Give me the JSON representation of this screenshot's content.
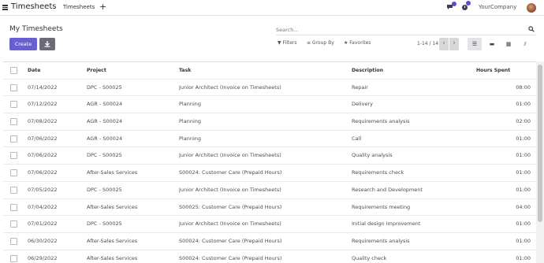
{
  "navbar": {
    "app_title": "Timesheets",
    "menu_link": "Timesheets",
    "add_label": "+",
    "company": "YourCompany",
    "accent": "#5b4dc9"
  },
  "control_panel": {
    "title": "My Timesheets",
    "create_label": "Create",
    "search_placeholder": "Search...",
    "filters_label": "▼ Filters",
    "groupby_label": "≡ Group By",
    "favorites_label": "★ Favorites",
    "pager": "1-14 / 14",
    "prev": "‹",
    "next": "›",
    "views": {
      "list": "☰",
      "kanban": "▬",
      "grid": "▦",
      "graph": "⫽"
    }
  },
  "table": {
    "headers": {
      "date": "Date",
      "project": "Project",
      "task": "Task",
      "description": "Description",
      "hours": "Hours Spent"
    },
    "rows": [
      {
        "date": "07/14/2022",
        "project": "DPC - S00025",
        "task": "Junior Architect (Invoice on Timesheets)",
        "description": "Repair",
        "hours": "08:00"
      },
      {
        "date": "07/12/2022",
        "project": "AGR - S00024",
        "task": "Planning",
        "description": "Delivery",
        "hours": "01:00"
      },
      {
        "date": "07/08/2022",
        "project": "AGR - S00024",
        "task": "Planning",
        "description": "Requirements analysis",
        "hours": "02:00"
      },
      {
        "date": "07/06/2022",
        "project": "AGR - S00024",
        "task": "Planning",
        "description": "Call",
        "hours": "01:00"
      },
      {
        "date": "07/06/2022",
        "project": "DPC - S00025",
        "task": "Junior Architect (Invoice on Timesheets)",
        "description": "Quality analysis",
        "hours": "01:00"
      },
      {
        "date": "07/06/2022",
        "project": "After-Sales Services",
        "task": "S00024: Customer Care (Prepaid Hours)",
        "description": "Requirements check",
        "hours": "01:00"
      },
      {
        "date": "07/05/2022",
        "project": "DPC - S00025",
        "task": "Junior Architect (Invoice on Timesheets)",
        "description": "Research and Development",
        "hours": "01:00"
      },
      {
        "date": "07/04/2022",
        "project": "After-Sales Services",
        "task": "S00025: Customer Care (Prepaid Hours)",
        "description": "Requirements meeting",
        "hours": "04:00"
      },
      {
        "date": "07/01/2022",
        "project": "DPC - S00025",
        "task": "Junior Architect (Invoice on Timesheets)",
        "description": "Initial design improvement",
        "hours": "01:00"
      },
      {
        "date": "06/30/2022",
        "project": "After-Sales Services",
        "task": "S00024: Customer Care (Prepaid Hours)",
        "description": "Requirements analysis",
        "hours": "01:00"
      },
      {
        "date": "06/29/2022",
        "project": "After-Sales Services",
        "task": "S00024: Customer Care (Prepaid Hours)",
        "description": "Quality check",
        "hours": "01:00"
      }
    ]
  }
}
